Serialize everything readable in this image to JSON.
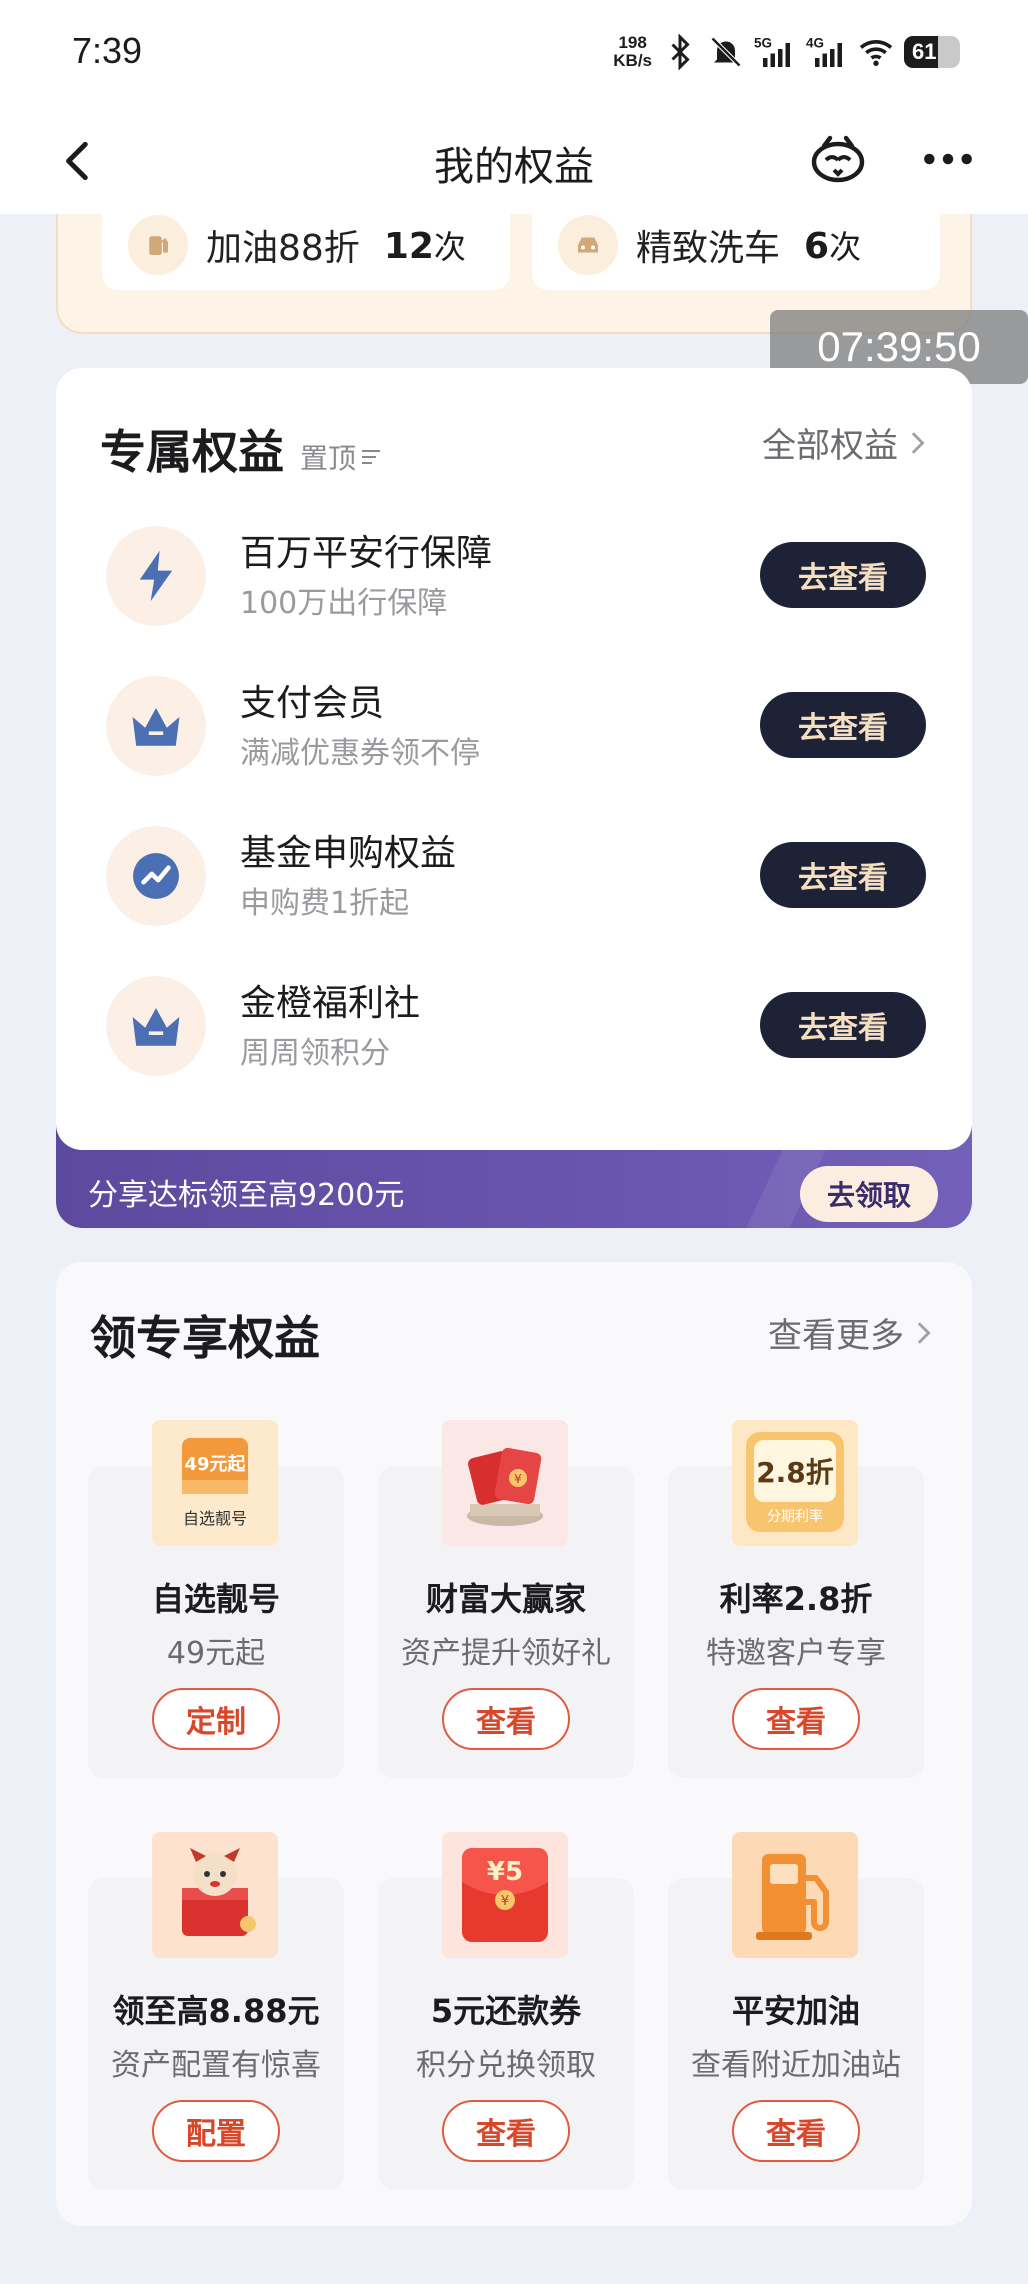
{
  "status_bar": {
    "time": "7:39",
    "net_speed_value": "198",
    "net_speed_unit": "KB/s",
    "signal_5g": "5G",
    "signal_4g": "4G",
    "battery": "61"
  },
  "nav": {
    "title": "我的权益"
  },
  "top_card": {
    "tiles": [
      {
        "label": "加油88折",
        "count": "12",
        "unit": "次"
      },
      {
        "label": "精致洗车",
        "count": "6",
        "unit": "次"
      }
    ]
  },
  "overlay_timestamp": "07:39:50",
  "exclusive": {
    "title": "专属权益",
    "pin_label": "置顶",
    "all_label": "全部权益",
    "items": [
      {
        "title": "百万平安行保障",
        "subtitle": "100万出行保障",
        "button": "去查看",
        "icon": "lightning-icon"
      },
      {
        "title": "支付会员",
        "subtitle": "满减优惠券领不停",
        "button": "去查看",
        "icon": "crown-icon"
      },
      {
        "title": "基金申购权益",
        "subtitle": "申购费1折起",
        "button": "去查看",
        "icon": "trend-icon"
      },
      {
        "title": "金橙福利社",
        "subtitle": "周周领积分",
        "button": "去查看",
        "icon": "crown-icon"
      }
    ],
    "banner_text": "分享达标领至高9200元",
    "banner_button": "去领取"
  },
  "special": {
    "title": "领专享权益",
    "more_label": "查看更多",
    "tiles": [
      {
        "title": "自选靓号",
        "subtitle": "49元起",
        "button": "定制",
        "img_text_top": "49元起",
        "img_text_bottom": "自选靓号"
      },
      {
        "title": "财富大赢家",
        "subtitle": "资产提升领好礼",
        "button": "查看"
      },
      {
        "title": "利率2.8折",
        "subtitle": "特邀客户专享",
        "button": "查看",
        "img_text_top": "2.8折",
        "img_text_bottom": "分期利率"
      },
      {
        "title": "领至高8.88元",
        "subtitle": "资产配置有惊喜",
        "button": "配置"
      },
      {
        "title": "5元还款券",
        "subtitle": "积分兑换领取",
        "button": "查看",
        "img_text_top": "¥5"
      },
      {
        "title": "平安加油",
        "subtitle": "查看附近加油站",
        "button": "查看"
      }
    ]
  },
  "colors": {
    "dark_button": "#1d2236",
    "dark_button_text": "#f5dfc0",
    "banner_purple": "#5d4a9e",
    "accent_red": "#e05a3f",
    "icon_blue": "#4a6fb3"
  }
}
